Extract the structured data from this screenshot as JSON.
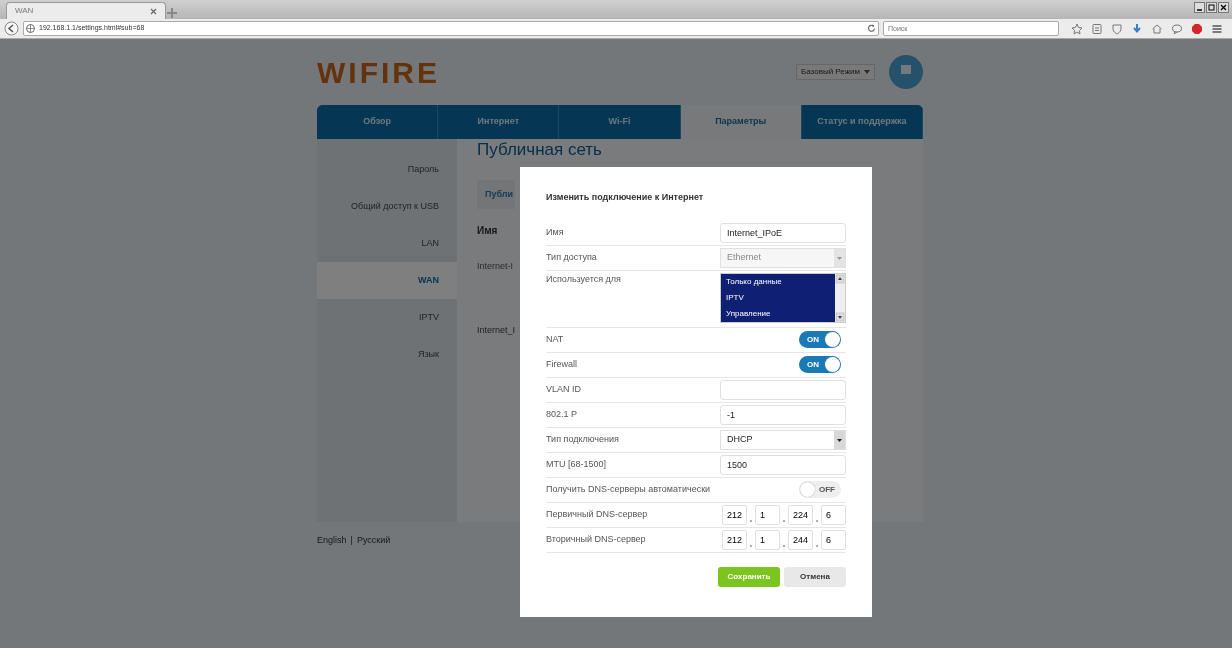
{
  "browser": {
    "tabs": [
      {
        "title": "WAN",
        "selected": true
      }
    ],
    "url": "192.168.1.1/settings.html#sub=68",
    "search": {
      "placeholder": "Поиск"
    }
  },
  "header": {
    "logo": "WIFIRE",
    "mode_select": "Базовый Режим"
  },
  "nav_tabs": [
    {
      "label": "Обзор",
      "selected": false
    },
    {
      "label": "Интернет",
      "selected": false
    },
    {
      "label": "Wi-Fi",
      "selected": false
    },
    {
      "label": "Параметры",
      "selected": true
    },
    {
      "label": "Статус и поддержка",
      "selected": false
    }
  ],
  "sidebar": {
    "items": [
      {
        "label": "Пароль",
        "selected": false
      },
      {
        "label": "Общий доступ к USB",
        "selected": false
      },
      {
        "label": "LAN",
        "selected": false
      },
      {
        "label": "WAN",
        "selected": true
      },
      {
        "label": "IPTV",
        "selected": false
      },
      {
        "label": "Язык",
        "selected": false
      }
    ]
  },
  "content": {
    "title": "Публичная сеть",
    "tab_label": "Публи",
    "column_header": "Имя",
    "rows": [
      "Internet-I",
      "Internet_I"
    ]
  },
  "footer": {
    "languages": [
      "English",
      "Русский"
    ],
    "separator": "|"
  },
  "dialog": {
    "title": "Изменить подключение к Интернет",
    "fields": [
      {
        "kind": "text",
        "label": "Имя",
        "value": "Internet_IPoE"
      },
      {
        "kind": "select",
        "label": "Тип доступа",
        "value": "Ethernet",
        "disabled": true
      },
      {
        "kind": "listbox",
        "label": "Используется для",
        "options": [
          {
            "label": "Только данные",
            "selected": true
          },
          {
            "label": "IPTV",
            "selected": true
          },
          {
            "label": "Управление",
            "selected": true
          }
        ]
      },
      {
        "kind": "toggle",
        "label": "NAT",
        "on": true,
        "text": "ON"
      },
      {
        "kind": "toggle",
        "label": "Firewall",
        "on": true,
        "text": "ON"
      },
      {
        "kind": "text",
        "label": "VLAN ID"
      },
      {
        "kind": "text",
        "label": "802.1 P",
        "value": "-1"
      },
      {
        "kind": "select",
        "label": "Тип подключения",
        "value": "DHCP",
        "disabled": false
      },
      {
        "kind": "text",
        "label": "MTU [68-1500]",
        "value": "1500"
      },
      {
        "kind": "toggle",
        "label": "Получить DNS-серверы автоматически",
        "on": false,
        "text": "OFF"
      },
      {
        "kind": "ip",
        "label": "Первичный DNS-сервер",
        "octets": [
          "212",
          "1",
          "224",
          "6"
        ]
      },
      {
        "kind": "ip",
        "label": "Вторичный DNS-сервер",
        "octets": [
          "212",
          "1",
          "244",
          "6"
        ]
      }
    ],
    "buttons": [
      {
        "kind": "primary",
        "label": "Сохранить"
      },
      {
        "kind": "secondary",
        "label": "Отмена"
      }
    ]
  }
}
